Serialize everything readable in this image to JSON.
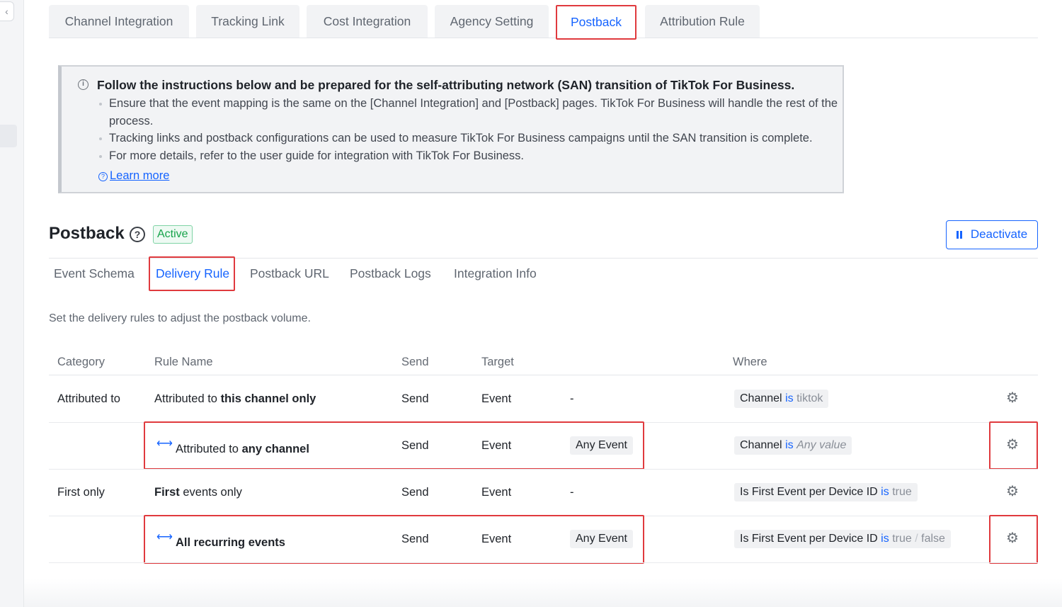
{
  "top_tabs": [
    {
      "label": "Channel Integration"
    },
    {
      "label": "Tracking Link"
    },
    {
      "label": "Cost Integration"
    },
    {
      "label": "Agency Setting"
    },
    {
      "label": "Postback",
      "active": true
    },
    {
      "label": "Attribution Rule"
    }
  ],
  "notice": {
    "title": "Follow the instructions below and be prepared for the self-attributing network (SAN) transition of TikTok For Business.",
    "items": [
      "Ensure that the event mapping is the same on the [Channel Integration] and [Postback] pages. TikTok For Business will handle the rest of the process.",
      "Tracking links and postback configurations can be used to measure TikTok For Business campaigns until the SAN transition is complete.",
      "For more details, refer to the user guide for integration with TikTok For Business."
    ],
    "learn_more": "Learn more"
  },
  "section": {
    "title": "Postback",
    "status": "Active",
    "deactivate_label": "Deactivate"
  },
  "sub_tabs": [
    {
      "label": "Event Schema"
    },
    {
      "label": "Delivery Rule",
      "active": true
    },
    {
      "label": "Postback URL"
    },
    {
      "label": "Postback Logs"
    },
    {
      "label": "Integration Info"
    }
  ],
  "description": "Set the delivery rules to adjust the postback volume.",
  "table": {
    "headers": [
      "Category",
      "Rule Name",
      "Send",
      "Target",
      "Where"
    ],
    "rows": [
      {
        "category": "Attributed to",
        "rule_prefix": "Attributed to ",
        "rule_bold": "this channel only",
        "send": "Send",
        "target": "Event",
        "target_value": "-",
        "where_field": "Channel",
        "where_op": "is",
        "where_value": "tiktok"
      },
      {
        "category": "",
        "rule_prefix": "Attributed to ",
        "rule_bold": "any channel",
        "send": "Send",
        "target": "Event",
        "target_value": "Any Event",
        "where_field": "Channel",
        "where_op": "is",
        "where_value": "Any value"
      },
      {
        "category": "First only",
        "rule_bold": "First",
        "rule_suffix": " events only",
        "send": "Send",
        "target": "Event",
        "target_value": "-",
        "where_field": "Is First Event per Device ID",
        "where_op": "is",
        "where_value": "true"
      },
      {
        "category": "",
        "rule_bold": "All recurring events",
        "send": "Send",
        "target": "Event",
        "target_value": "Any Event",
        "where_field": "Is First Event per Device ID",
        "where_op": "is",
        "where_value": "true",
        "where_sep": "/",
        "where_value2": "false"
      }
    ]
  },
  "icons": {
    "collapse": "chevron-left-icon",
    "info": "info-icon",
    "help": "question-circle-icon",
    "pause": "pause-icon",
    "swap": "swap-arrows-icon",
    "settings": "gear-icon"
  },
  "colors": {
    "accent": "#1664ff",
    "highlight_box": "#e03a3e",
    "active_badge": "#16a34a"
  }
}
